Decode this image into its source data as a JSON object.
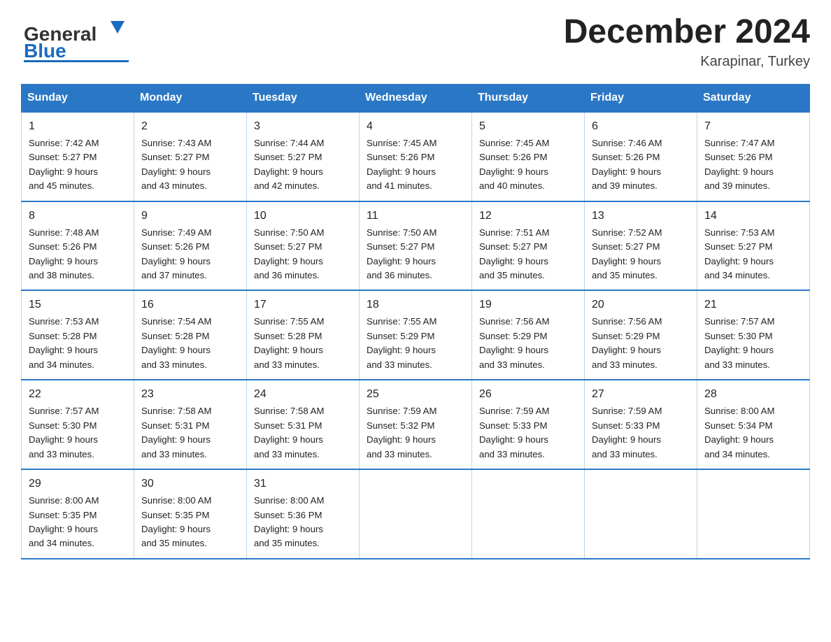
{
  "header": {
    "logo_general": "General",
    "logo_blue": "Blue",
    "month_title": "December 2024",
    "location": "Karapinar, Turkey"
  },
  "days_of_week": [
    "Sunday",
    "Monday",
    "Tuesday",
    "Wednesday",
    "Thursday",
    "Friday",
    "Saturday"
  ],
  "weeks": [
    [
      {
        "day": "1",
        "sunrise": "7:42 AM",
        "sunset": "5:27 PM",
        "daylight": "9 hours and 45 minutes."
      },
      {
        "day": "2",
        "sunrise": "7:43 AM",
        "sunset": "5:27 PM",
        "daylight": "9 hours and 43 minutes."
      },
      {
        "day": "3",
        "sunrise": "7:44 AM",
        "sunset": "5:27 PM",
        "daylight": "9 hours and 42 minutes."
      },
      {
        "day": "4",
        "sunrise": "7:45 AM",
        "sunset": "5:26 PM",
        "daylight": "9 hours and 41 minutes."
      },
      {
        "day": "5",
        "sunrise": "7:45 AM",
        "sunset": "5:26 PM",
        "daylight": "9 hours and 40 minutes."
      },
      {
        "day": "6",
        "sunrise": "7:46 AM",
        "sunset": "5:26 PM",
        "daylight": "9 hours and 39 minutes."
      },
      {
        "day": "7",
        "sunrise": "7:47 AM",
        "sunset": "5:26 PM",
        "daylight": "9 hours and 39 minutes."
      }
    ],
    [
      {
        "day": "8",
        "sunrise": "7:48 AM",
        "sunset": "5:26 PM",
        "daylight": "9 hours and 38 minutes."
      },
      {
        "day": "9",
        "sunrise": "7:49 AM",
        "sunset": "5:26 PM",
        "daylight": "9 hours and 37 minutes."
      },
      {
        "day": "10",
        "sunrise": "7:50 AM",
        "sunset": "5:27 PM",
        "daylight": "9 hours and 36 minutes."
      },
      {
        "day": "11",
        "sunrise": "7:50 AM",
        "sunset": "5:27 PM",
        "daylight": "9 hours and 36 minutes."
      },
      {
        "day": "12",
        "sunrise": "7:51 AM",
        "sunset": "5:27 PM",
        "daylight": "9 hours and 35 minutes."
      },
      {
        "day": "13",
        "sunrise": "7:52 AM",
        "sunset": "5:27 PM",
        "daylight": "9 hours and 35 minutes."
      },
      {
        "day": "14",
        "sunrise": "7:53 AM",
        "sunset": "5:27 PM",
        "daylight": "9 hours and 34 minutes."
      }
    ],
    [
      {
        "day": "15",
        "sunrise": "7:53 AM",
        "sunset": "5:28 PM",
        "daylight": "9 hours and 34 minutes."
      },
      {
        "day": "16",
        "sunrise": "7:54 AM",
        "sunset": "5:28 PM",
        "daylight": "9 hours and 33 minutes."
      },
      {
        "day": "17",
        "sunrise": "7:55 AM",
        "sunset": "5:28 PM",
        "daylight": "9 hours and 33 minutes."
      },
      {
        "day": "18",
        "sunrise": "7:55 AM",
        "sunset": "5:29 PM",
        "daylight": "9 hours and 33 minutes."
      },
      {
        "day": "19",
        "sunrise": "7:56 AM",
        "sunset": "5:29 PM",
        "daylight": "9 hours and 33 minutes."
      },
      {
        "day": "20",
        "sunrise": "7:56 AM",
        "sunset": "5:29 PM",
        "daylight": "9 hours and 33 minutes."
      },
      {
        "day": "21",
        "sunrise": "7:57 AM",
        "sunset": "5:30 PM",
        "daylight": "9 hours and 33 minutes."
      }
    ],
    [
      {
        "day": "22",
        "sunrise": "7:57 AM",
        "sunset": "5:30 PM",
        "daylight": "9 hours and 33 minutes."
      },
      {
        "day": "23",
        "sunrise": "7:58 AM",
        "sunset": "5:31 PM",
        "daylight": "9 hours and 33 minutes."
      },
      {
        "day": "24",
        "sunrise": "7:58 AM",
        "sunset": "5:31 PM",
        "daylight": "9 hours and 33 minutes."
      },
      {
        "day": "25",
        "sunrise": "7:59 AM",
        "sunset": "5:32 PM",
        "daylight": "9 hours and 33 minutes."
      },
      {
        "day": "26",
        "sunrise": "7:59 AM",
        "sunset": "5:33 PM",
        "daylight": "9 hours and 33 minutes."
      },
      {
        "day": "27",
        "sunrise": "7:59 AM",
        "sunset": "5:33 PM",
        "daylight": "9 hours and 33 minutes."
      },
      {
        "day": "28",
        "sunrise": "8:00 AM",
        "sunset": "5:34 PM",
        "daylight": "9 hours and 34 minutes."
      }
    ],
    [
      {
        "day": "29",
        "sunrise": "8:00 AM",
        "sunset": "5:35 PM",
        "daylight": "9 hours and 34 minutes."
      },
      {
        "day": "30",
        "sunrise": "8:00 AM",
        "sunset": "5:35 PM",
        "daylight": "9 hours and 35 minutes."
      },
      {
        "day": "31",
        "sunrise": "8:00 AM",
        "sunset": "5:36 PM",
        "daylight": "9 hours and 35 minutes."
      },
      null,
      null,
      null,
      null
    ]
  ],
  "labels": {
    "sunrise": "Sunrise: ",
    "sunset": "Sunset: ",
    "daylight": "Daylight: "
  }
}
